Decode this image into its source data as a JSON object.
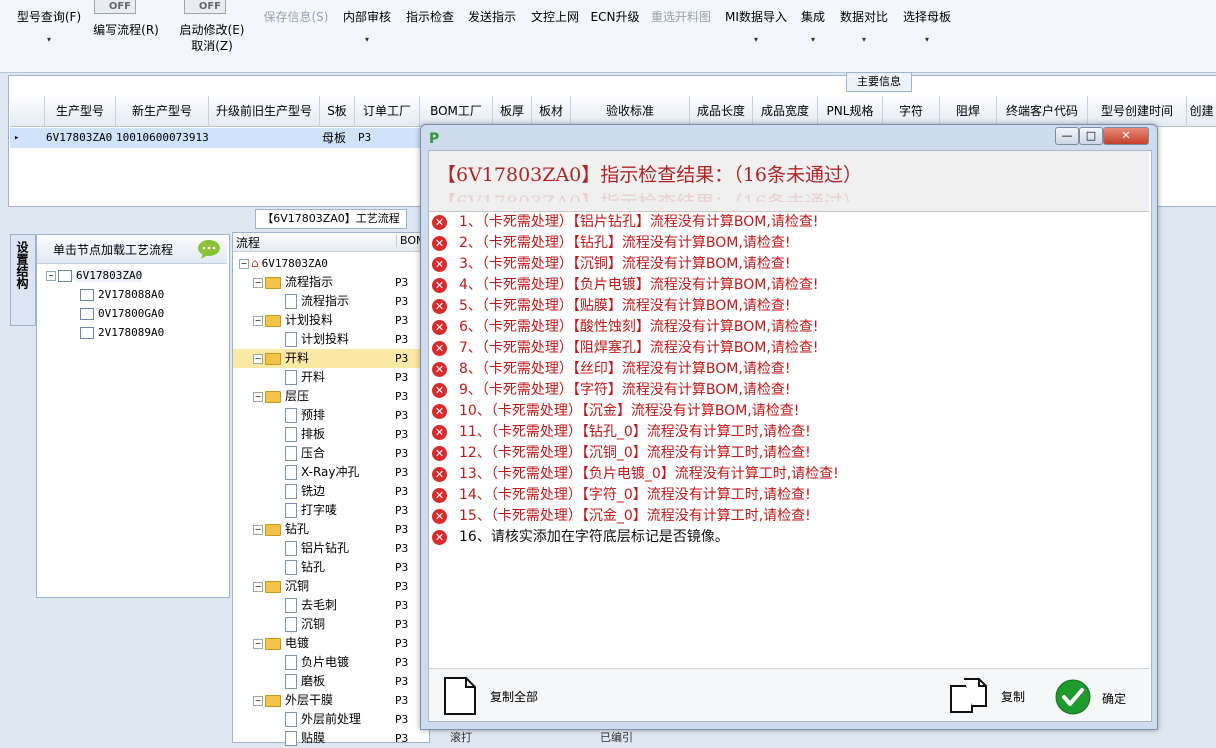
{
  "toolbar": {
    "model_query": "型号查询(F)",
    "write_process": "编写流程(R)",
    "enable_modify": "启动修改(E)",
    "cancel": "取消(Z)",
    "toggle1": "OFF",
    "toggle2": "OFF",
    "save_info": "保存信息(S)",
    "internal_review": "内部审核",
    "indicator_check": "指示检查",
    "send_indicator": "发送指示",
    "doc_online": "文控上网",
    "ecn_upgrade": "ECN升级",
    "reselect_cut": "重选开料图",
    "mi_import": "MI数据导入",
    "integrate": "集成",
    "data_compare": "数据对比",
    "select_master": "选择母板",
    "caret": "▾"
  },
  "main_info": {
    "caption": "主要信息",
    "columns": [
      "生产型号",
      "新生产型号",
      "升级前旧生产型号",
      "S板",
      "订单工厂",
      "BOM工厂",
      "板厚",
      "板材",
      "验收标准",
      "成品长度",
      "成品宽度",
      "PNL规格",
      "字符",
      "阻焊",
      "终端客户代码",
      "型号创建时间",
      "创建"
    ],
    "row": {
      "marker": "▸",
      "model": "6V17803ZA0",
      "new_model": "10010600073913",
      "board": "母板",
      "factory": "P3"
    }
  },
  "left_tab": {
    "label": "设置结构"
  },
  "node_panel": {
    "header": "单击节点加载工艺流程",
    "root": "6V17803ZA0",
    "children": [
      "2V178088A0",
      "0V17800GA0",
      "2V178089A0"
    ]
  },
  "process_panel": {
    "caption": "【6V17803ZA0】工艺流程",
    "col_flow": "流程",
    "col_bom": "BOM",
    "root": "6V17803ZA0",
    "rows": [
      {
        "label": "流程指示",
        "type": "folder",
        "bom": "P3"
      },
      {
        "label": "流程指示",
        "type": "doc",
        "bom": "P3"
      },
      {
        "label": "计划投料",
        "type": "folder",
        "bom": "P3"
      },
      {
        "label": "计划投料",
        "type": "doc",
        "bom": "P3"
      },
      {
        "label": "开料",
        "type": "folder",
        "bom": "P3"
      },
      {
        "label": "开料",
        "type": "doc",
        "bom": "P3"
      },
      {
        "label": "层压",
        "type": "folder",
        "bom": "P3"
      },
      {
        "label": "预排",
        "type": "doc",
        "bom": "P3"
      },
      {
        "label": "排板",
        "type": "doc",
        "bom": "P3"
      },
      {
        "label": "压合",
        "type": "doc",
        "bom": "P3"
      },
      {
        "label": "X-Ray冲孔",
        "type": "doc",
        "bom": "P3"
      },
      {
        "label": "铣边",
        "type": "doc",
        "bom": "P3"
      },
      {
        "label": "打字唛",
        "type": "doc",
        "bom": "P3"
      },
      {
        "label": "钻孔",
        "type": "folder",
        "bom": "P3"
      },
      {
        "label": "铝片钻孔",
        "type": "doc",
        "bom": "P3"
      },
      {
        "label": "钻孔",
        "type": "doc",
        "bom": "P3"
      },
      {
        "label": "沉铜",
        "type": "folder",
        "bom": "P3"
      },
      {
        "label": "去毛刺",
        "type": "doc",
        "bom": "P3"
      },
      {
        "label": "沉铜",
        "type": "doc",
        "bom": "P3"
      },
      {
        "label": "电镀",
        "type": "folder",
        "bom": "P3"
      },
      {
        "label": "负片电镀",
        "type": "doc",
        "bom": "P3"
      },
      {
        "label": "磨板",
        "type": "doc",
        "bom": "P3"
      },
      {
        "label": "外层干膜",
        "type": "folder",
        "bom": "P3"
      },
      {
        "label": "外层前处理",
        "type": "doc",
        "bom": "P3"
      },
      {
        "label": "贴膜",
        "type": "doc",
        "bom": "P3"
      }
    ]
  },
  "background_text": {
    "a": "滚打",
    "b": "已编引"
  },
  "dialog": {
    "win_min": "—",
    "win_max": "□",
    "win_close": "✕",
    "title": "【6V17803ZA0】指示检查结果：（16条未通过）",
    "messages": [
      "1、（卡死需处理）【铝片钻孔】流程没有计算BOM,请检查!",
      "2、（卡死需处理）【钻孔】流程没有计算BOM,请检查!",
      "3、（卡死需处理）【沉铜】流程没有计算BOM,请检查!",
      "4、（卡死需处理）【负片电镀】流程没有计算BOM,请检查!",
      "5、（卡死需处理）【贴膜】流程没有计算BOM,请检查!",
      "6、（卡死需处理）【酸性蚀刻】流程没有计算BOM,请检查!",
      "7、（卡死需处理）【阻焊塞孔】流程没有计算BOM,请检查!",
      "8、（卡死需处理）【丝印】流程没有计算BOM,请检查!",
      "9、（卡死需处理）【字符】流程没有计算BOM,请检查!",
      "10、（卡死需处理）【沉金】流程没有计算BOM,请检查!",
      "11、（卡死需处理）【钻孔_0】流程没有计算工时,请检查!",
      "12、（卡死需处理）【沉铜_0】流程没有计算工时,请检查!",
      "13、（卡死需处理）【负片电镀_0】流程没有计算工时,请检查!",
      "14、（卡死需处理）【字符_0】流程没有计算工时,请检查!",
      "15、（卡死需处理）【沉金_0】流程没有计算工时,请检查!",
      "16、请核实添加在字符底层标记是否镜像。"
    ],
    "error_symbol": "✕",
    "copy_all": "复制全部",
    "copy": "复制",
    "ok": "确定",
    "colors": {
      "error_text": "#c41818",
      "title": "#b02424",
      "ok_green": "#1f9a2f"
    }
  }
}
